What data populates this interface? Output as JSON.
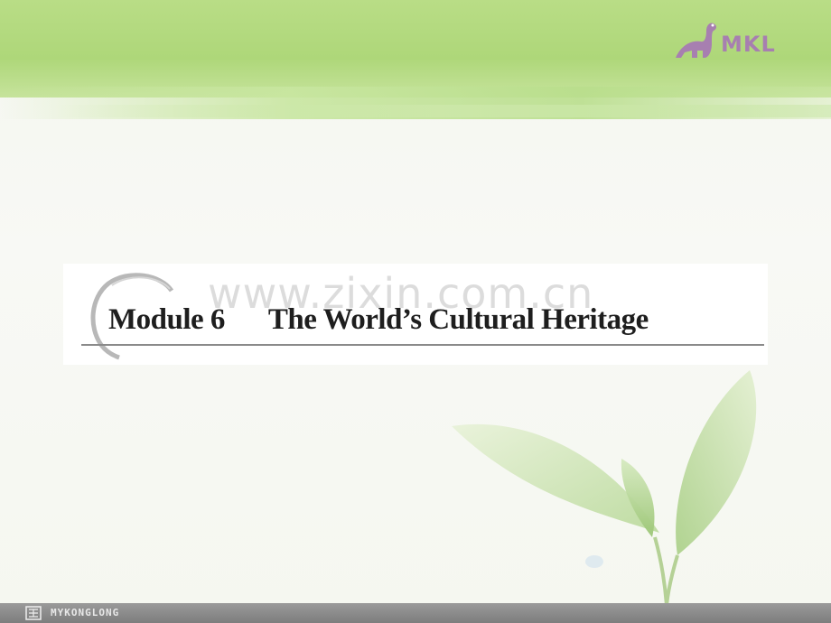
{
  "slide": {
    "title_module": "Module 6",
    "title_main": "The World’s Cultural Heritage",
    "watermark": "www.zixin.com.cn"
  },
  "branding": {
    "logo_text": "MKL",
    "footer_text": "MYKONGLONG"
  },
  "colors": {
    "band_green": "#b1d87c",
    "logo_purple": "#a77fb0",
    "footer_gray": "#8a8a8a"
  }
}
